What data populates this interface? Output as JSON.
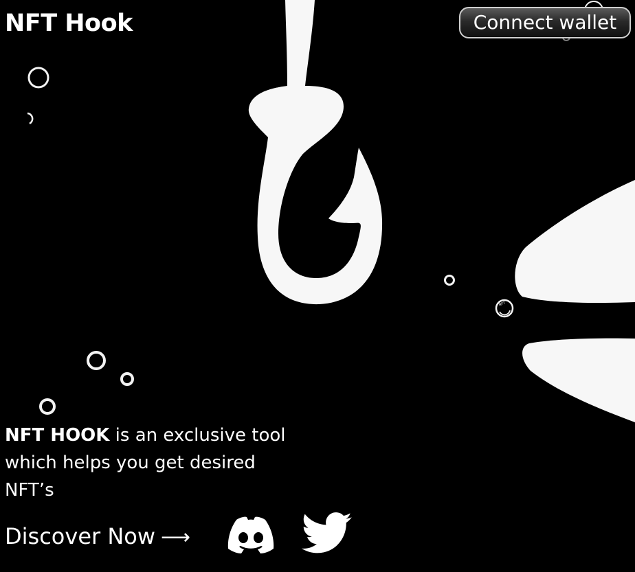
{
  "brand": {
    "logo_text": "NFT Hook"
  },
  "header": {
    "connect_wallet_label": "Connect wallet"
  },
  "hero": {
    "tagline_bold": "NFT HOOK",
    "tagline_rest": " is an exclusive tool which helps you get desired NFT’s",
    "discover_label": "Discover Now",
    "discover_arrow": "⟶",
    "coin_label": "NFT"
  },
  "social": [
    {
      "name": "discord",
      "icon": "discord-icon"
    },
    {
      "name": "twitter",
      "icon": "twitter-icon"
    }
  ],
  "colors": {
    "background": "#000000",
    "foreground": "#ffffff",
    "button_border": "#cfcfcf"
  }
}
